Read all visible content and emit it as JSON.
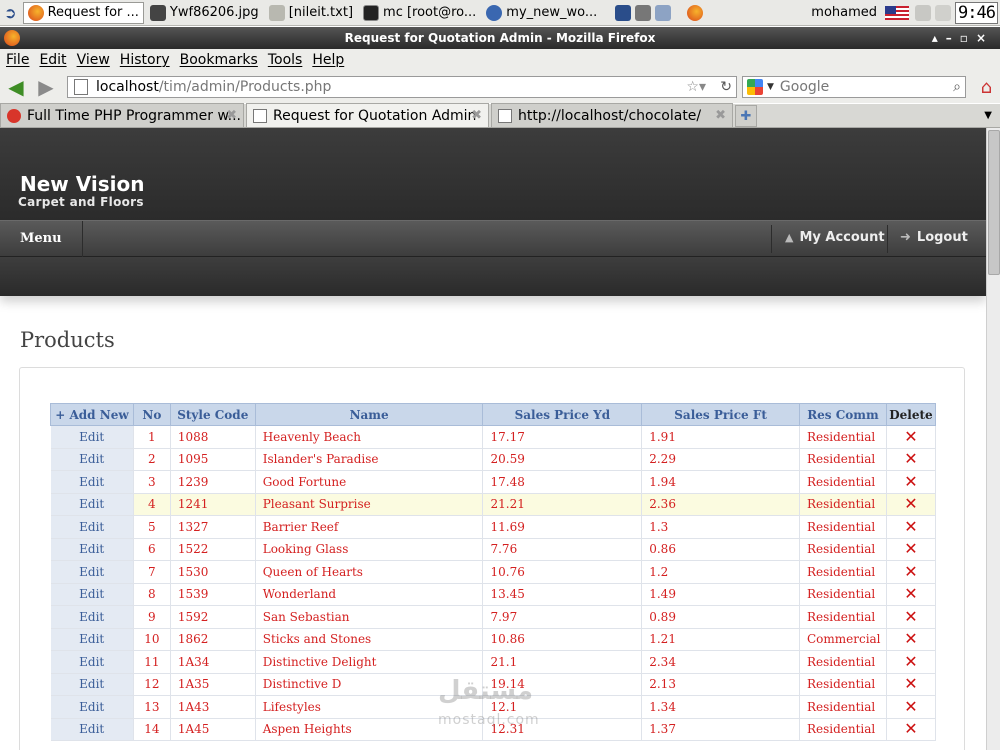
{
  "taskbar": {
    "items": [
      {
        "label": "Request for ...",
        "active": true
      },
      {
        "label": "Ywf86206.jpg",
        "active": false
      },
      {
        "label": "[nileit.txt]",
        "active": false
      },
      {
        "label": "mc [root@ro...",
        "active": false
      },
      {
        "label": "my_new_wo...",
        "active": false
      }
    ],
    "user": "mohamed",
    "clock": "9:46"
  },
  "window": {
    "title": "Request for Quotation Admin - Mozilla Firefox"
  },
  "menubar": {
    "items": [
      "File",
      "Edit",
      "View",
      "History",
      "Bookmarks",
      "Tools",
      "Help"
    ]
  },
  "navbar": {
    "url_host": "localhost",
    "url_path": "/tim/admin/Products.php",
    "search_placeholder": "Google"
  },
  "tabs": [
    {
      "label": "Full Time PHP Programmer w...",
      "active": false
    },
    {
      "label": "Request for Quotation Admin",
      "active": true
    },
    {
      "label": "http://localhost/chocolate/",
      "active": false
    }
  ],
  "site": {
    "brand": "New Vision",
    "brand_sub": "Carpet and Floors",
    "menu_label": "Menu",
    "account_label": "My Account",
    "logout_label": "Logout"
  },
  "page": {
    "title": "Products"
  },
  "table": {
    "headers": [
      "+ Add New",
      "No",
      "Style Code",
      "Name",
      "Sales Price Yd",
      "Sales Price Ft",
      "Res Comm",
      "Delete"
    ],
    "edit_label": "Edit",
    "delete_glyph": "✕",
    "highlight_row": 4,
    "rows": [
      {
        "no": "1",
        "code": "1088",
        "name": "Heavenly Beach",
        "yd": "17.17",
        "ft": "1.91",
        "rc": "Residential"
      },
      {
        "no": "2",
        "code": "1095",
        "name": "Islander's Paradise",
        "yd": "20.59",
        "ft": "2.29",
        "rc": "Residential"
      },
      {
        "no": "3",
        "code": "1239",
        "name": "Good Fortune",
        "yd": "17.48",
        "ft": "1.94",
        "rc": "Residential"
      },
      {
        "no": "4",
        "code": "1241",
        "name": "Pleasant Surprise",
        "yd": "21.21",
        "ft": "2.36",
        "rc": "Residential"
      },
      {
        "no": "5",
        "code": "1327",
        "name": "Barrier Reef",
        "yd": "11.69",
        "ft": "1.3",
        "rc": "Residential"
      },
      {
        "no": "6",
        "code": "1522",
        "name": "Looking Glass",
        "yd": "7.76",
        "ft": "0.86",
        "rc": "Residential"
      },
      {
        "no": "7",
        "code": "1530",
        "name": "Queen of Hearts",
        "yd": "10.76",
        "ft": "1.2",
        "rc": "Residential"
      },
      {
        "no": "8",
        "code": "1539",
        "name": "Wonderland",
        "yd": "13.45",
        "ft": "1.49",
        "rc": "Residential"
      },
      {
        "no": "9",
        "code": "1592",
        "name": "San Sebastian",
        "yd": "7.97",
        "ft": "0.89",
        "rc": "Residential"
      },
      {
        "no": "10",
        "code": "1862",
        "name": "Sticks and Stones",
        "yd": "10.86",
        "ft": "1.21",
        "rc": "Commercial"
      },
      {
        "no": "11",
        "code": "1A34",
        "name": "Distinctive Delight",
        "yd": "21.1",
        "ft": "2.34",
        "rc": "Residential"
      },
      {
        "no": "12",
        "code": "1A35",
        "name": "Distinctive D",
        "yd": "19.14",
        "ft": "2.13",
        "rc": "Residential"
      },
      {
        "no": "13",
        "code": "1A43",
        "name": "Lifestyles",
        "yd": "12.1",
        "ft": "1.34",
        "rc": "Residential"
      },
      {
        "no": "14",
        "code": "1A45",
        "name": "Aspen Heights",
        "yd": "12.31",
        "ft": "1.37",
        "rc": "Residential"
      }
    ]
  },
  "watermark": {
    "text": "مستقل",
    "sub": "mostaql.com"
  },
  "colors": {
    "header_dark": "#2b2b2b",
    "table_header": "#c9d7ea",
    "cell_text": "#d42020",
    "link_blue": "#3a5d98",
    "highlight": "#fbfbe0"
  }
}
